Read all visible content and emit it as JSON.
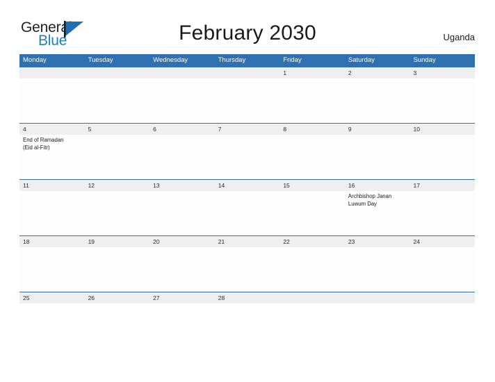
{
  "branding": {
    "logo_text_primary": "General",
    "logo_text_secondary": "Blue",
    "logo_flag_icon": "blue-triangle-flag-icon",
    "accent_color": "#2e70b0",
    "logo_blue": "#1f7fc4"
  },
  "header": {
    "title": "February 2030",
    "country": "Uganda"
  },
  "calendar": {
    "weekdays": [
      "Monday",
      "Tuesday",
      "Wednesday",
      "Thursday",
      "Friday",
      "Saturday",
      "Sunday"
    ],
    "weeks": [
      {
        "days": [
          {
            "date": "",
            "event": ""
          },
          {
            "date": "",
            "event": ""
          },
          {
            "date": "",
            "event": ""
          },
          {
            "date": "",
            "event": ""
          },
          {
            "date": "1",
            "event": ""
          },
          {
            "date": "2",
            "event": ""
          },
          {
            "date": "3",
            "event": ""
          }
        ]
      },
      {
        "days": [
          {
            "date": "4",
            "event": "End of Ramadan\n(Eid al-Fitr)"
          },
          {
            "date": "5",
            "event": ""
          },
          {
            "date": "6",
            "event": ""
          },
          {
            "date": "7",
            "event": ""
          },
          {
            "date": "8",
            "event": ""
          },
          {
            "date": "9",
            "event": ""
          },
          {
            "date": "10",
            "event": ""
          }
        ]
      },
      {
        "days": [
          {
            "date": "11",
            "event": ""
          },
          {
            "date": "12",
            "event": ""
          },
          {
            "date": "13",
            "event": ""
          },
          {
            "date": "14",
            "event": ""
          },
          {
            "date": "15",
            "event": ""
          },
          {
            "date": "16",
            "event": "Archbishop Janan\nLuwum Day"
          },
          {
            "date": "17",
            "event": ""
          }
        ]
      },
      {
        "days": [
          {
            "date": "18",
            "event": ""
          },
          {
            "date": "19",
            "event": ""
          },
          {
            "date": "20",
            "event": ""
          },
          {
            "date": "21",
            "event": ""
          },
          {
            "date": "22",
            "event": ""
          },
          {
            "date": "23",
            "event": ""
          },
          {
            "date": "24",
            "event": ""
          }
        ]
      },
      {
        "days": [
          {
            "date": "25",
            "event": ""
          },
          {
            "date": "26",
            "event": ""
          },
          {
            "date": "27",
            "event": ""
          },
          {
            "date": "28",
            "event": ""
          },
          {
            "date": "",
            "event": ""
          },
          {
            "date": "",
            "event": ""
          },
          {
            "date": "",
            "event": ""
          }
        ]
      }
    ]
  }
}
